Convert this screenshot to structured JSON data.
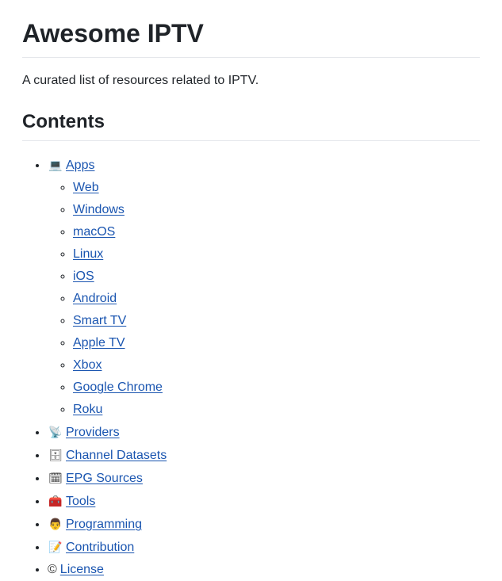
{
  "title": "Awesome IPTV",
  "intro": "A curated list of resources related to IPTV.",
  "contents_heading": "Contents",
  "toc": {
    "apps": {
      "icon": "laptop-icon",
      "label": "Apps",
      "children": [
        "Web",
        "Windows",
        "macOS",
        "Linux",
        "iOS",
        "Android",
        "Smart TV",
        "Apple TV",
        "Xbox",
        "Google Chrome",
        "Roku"
      ]
    },
    "providers": {
      "icon": "satellite-antenna-icon",
      "label": "Providers"
    },
    "channel_datasets": {
      "icon": "file-cabinet-icon",
      "label": "Channel Datasets"
    },
    "epg_sources": {
      "icon": "calendar-icon",
      "label": "EPG Sources"
    },
    "tools": {
      "icon": "toolbox-icon",
      "label": "Tools"
    },
    "programming": {
      "icon": "technologist-icon",
      "label": "Programming"
    },
    "contribution": {
      "icon": "memo-icon",
      "label": "Contribution"
    },
    "license": {
      "icon": "copyright-icon",
      "label": "License"
    }
  },
  "colors": {
    "link": "#1a55b0",
    "text": "#1f2328",
    "rule": "#e5e7eb"
  }
}
